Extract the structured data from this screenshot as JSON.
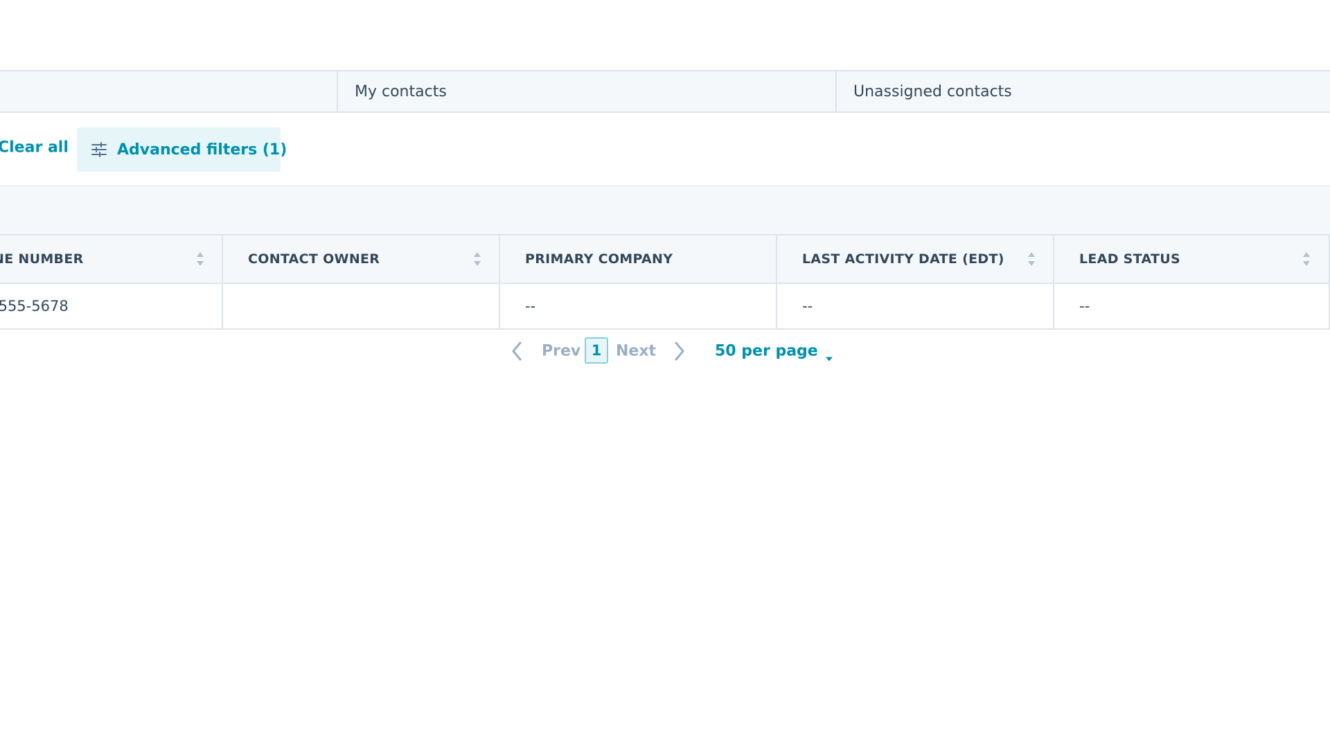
{
  "tabs": [
    {
      "label": ""
    },
    {
      "label": "My contacts"
    },
    {
      "label": "Unassigned contacts"
    }
  ],
  "filters": {
    "clear_all_label": "Clear all",
    "advanced_filters_label": "Advanced filters (1)",
    "advanced_filters_icon": "sliders-icon"
  },
  "table": {
    "columns": [
      {
        "label": "NE NUMBER",
        "sortable": true
      },
      {
        "label": "CONTACT OWNER",
        "sortable": true
      },
      {
        "label": "PRIMARY COMPANY",
        "sortable": false
      },
      {
        "label": "LAST ACTIVITY DATE (EDT)",
        "sortable": true
      },
      {
        "label": "LEAD STATUS",
        "sortable": true
      }
    ],
    "rows": [
      [
        "-555-5678",
        "",
        "--",
        "--",
        "--"
      ]
    ]
  },
  "pagination": {
    "prev_label": "Prev",
    "current_page": "1",
    "next_label": "Next",
    "per_page_label": "50 per page"
  },
  "colors": {
    "accent": "#0091ae",
    "text": "#33475b",
    "muted": "#99afc4",
    "border": "#dfe3eb",
    "panel": "#f5f8fa"
  }
}
